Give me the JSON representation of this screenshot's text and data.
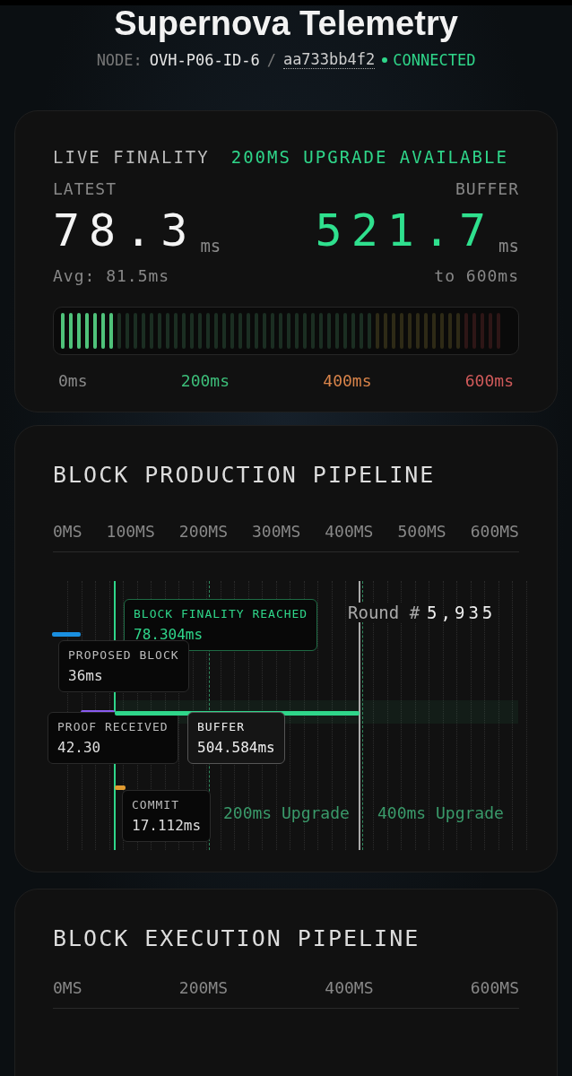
{
  "header": {
    "title": "Supernova Telemetry",
    "node_label": "NODE:",
    "node_id": "OVH-P06-ID-6",
    "separator": "/",
    "hash": "aa733bb4f2",
    "status": "CONNECTED",
    "connected": true
  },
  "finality": {
    "title": "LIVE FINALITY",
    "badge": "200MS UPGRADE AVAILABLE",
    "latest_label": "LATEST",
    "latest_value": "78.3",
    "latest_unit": "ms",
    "avg": "Avg: 81.5ms",
    "buffer_label": "BUFFER",
    "buffer_value": "521.7",
    "buffer_unit": "ms",
    "buffer_note": "to 600ms",
    "meter": {
      "level": 0.13
    },
    "scale": [
      {
        "label": "0ms",
        "color": "#8a8a8a"
      },
      {
        "label": "200ms",
        "color": "#3dbf7a"
      },
      {
        "label": "400ms",
        "color": "#d9844a"
      },
      {
        "label": "600ms",
        "color": "#d05a5a"
      }
    ]
  },
  "production": {
    "title": "BLOCK PRODUCTION PIPELINE",
    "ticks": [
      "0MS",
      "100MS",
      "200MS",
      "300MS",
      "400MS",
      "500MS",
      "600MS"
    ],
    "round_label": "Round #",
    "round": "5,935",
    "events": [
      {
        "kind": "finality",
        "label": "BLOCK FINALITY REACHED",
        "value": "78.304ms",
        "color": "#2fd68a"
      },
      {
        "kind": "proposed",
        "label": "PROPOSED BLOCK",
        "value": "36ms",
        "color": "#1a8fe0"
      },
      {
        "kind": "proof",
        "label": "PROOF RECEIVED",
        "value": "42.30",
        "color": "#8a5cf0"
      },
      {
        "kind": "buffer",
        "label": "BUFFER",
        "value": "504.584ms",
        "color": "#2fd68a"
      },
      {
        "kind": "commit",
        "label": "COMMIT",
        "value": "17.112ms",
        "color": "#e09a30"
      }
    ],
    "markers": [
      {
        "label": "200ms Upgrade"
      },
      {
        "label": "400ms Upgrade"
      }
    ]
  },
  "execution": {
    "title": "BLOCK EXECUTION PIPELINE",
    "ticks": [
      "0MS",
      "200MS",
      "400MS",
      "600MS"
    ]
  }
}
